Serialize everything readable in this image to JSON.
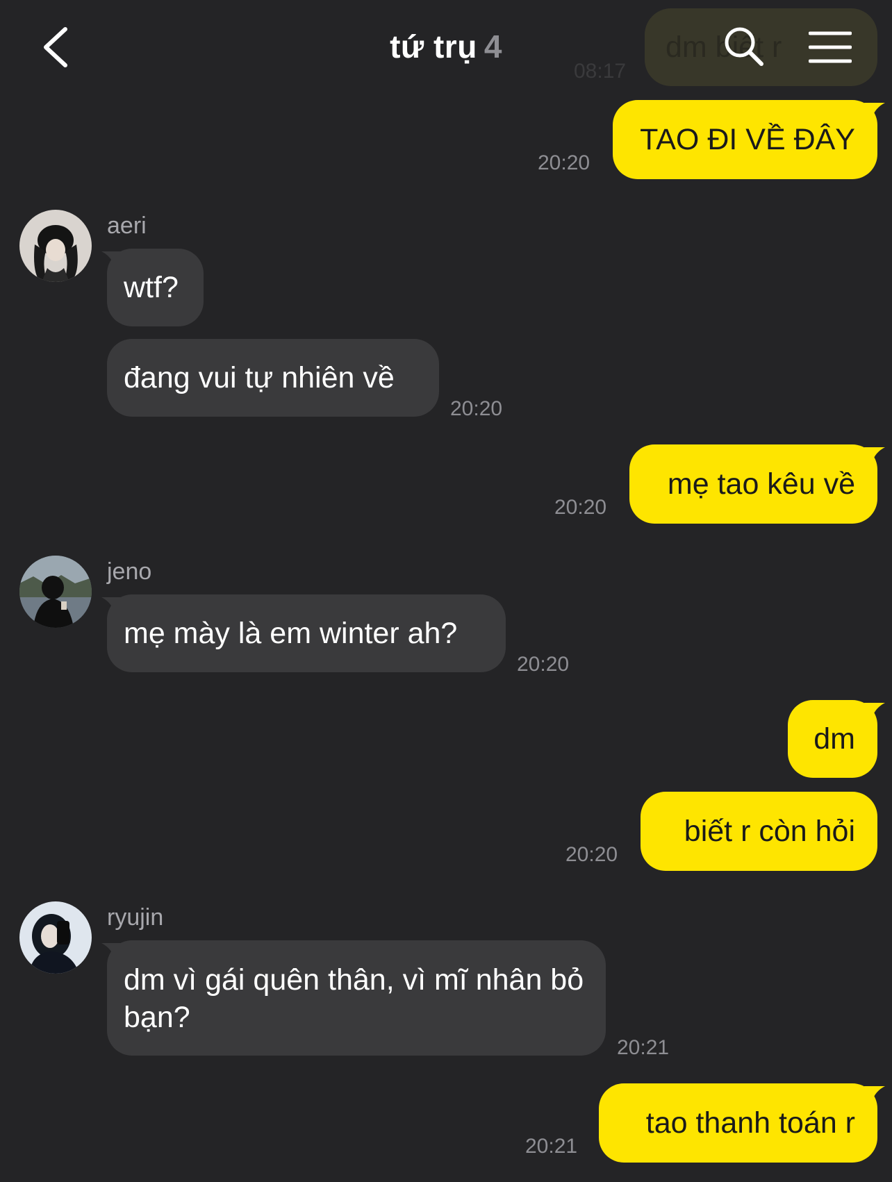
{
  "header": {
    "title": "tứ trụ",
    "member_count": "4",
    "back_icon": "chevron-left-icon",
    "search_icon": "search-icon",
    "menu_icon": "hamburger-menu-icon"
  },
  "colors": {
    "background": "#242426",
    "outgoing_bubble": "#fee500",
    "incoming_bubble": "#3a3a3c",
    "timestamp": "#8e8e93"
  },
  "partial_top": {
    "text": "dm biết r",
    "time": "08:17"
  },
  "messages": [
    {
      "sender": "me",
      "text": "TAO ĐI VỀ ĐÂY",
      "time": "20:20"
    },
    {
      "sender": "aeri",
      "name": "aeri",
      "text": "wtf?"
    },
    {
      "sender": "aeri",
      "text": "đang vui tự nhiên về",
      "time": "20:20"
    },
    {
      "sender": "me",
      "text": "mẹ tao kêu về",
      "time": "20:20"
    },
    {
      "sender": "jeno",
      "name": "jeno",
      "text": "mẹ mày là em winter ah?",
      "time": "20:20"
    },
    {
      "sender": "me",
      "text": "dm"
    },
    {
      "sender": "me",
      "text": "biết r còn hỏi",
      "time": "20:20"
    },
    {
      "sender": "ryujin",
      "name": "ryujin",
      "text": "dm vì gái quên thân, vì mĩ nhân bỏ bạn?",
      "time": "20:21"
    },
    {
      "sender": "me",
      "text": "tao thanh toán r",
      "time": "20:21"
    }
  ]
}
